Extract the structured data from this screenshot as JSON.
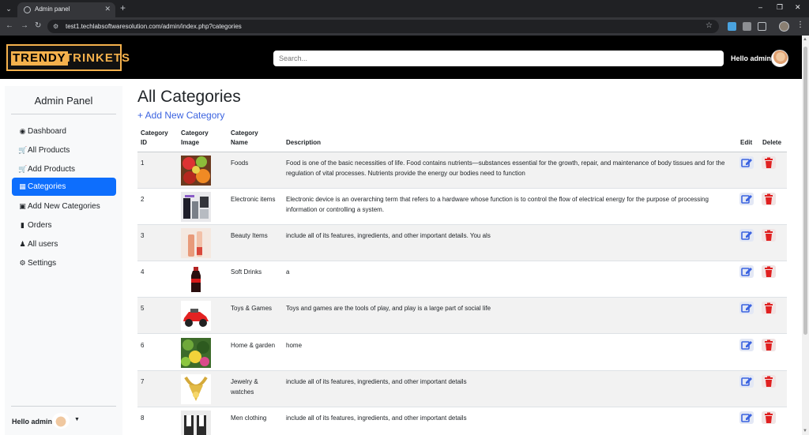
{
  "browser": {
    "tab_title": "Admin panel",
    "url": "test1.techlabsoftwaresolution.com/admin/index.php?categories"
  },
  "header": {
    "logo_part1": "TRENDY",
    "logo_part2": "TRINKETS",
    "search_placeholder": "Search...",
    "greeting": "Hello admin"
  },
  "sidebar": {
    "title": "Admin Panel",
    "items": [
      {
        "label": "Dashboard",
        "icon": "palette-icon"
      },
      {
        "label": "All Products",
        "icon": "cart-icon"
      },
      {
        "label": "Add Products",
        "icon": "cart-plus-icon"
      },
      {
        "label": "Categories",
        "icon": "calendar-grid-icon",
        "active": true
      },
      {
        "label": "Add New Categories",
        "icon": "calendar-plus-icon"
      },
      {
        "label": "Orders",
        "icon": "book-icon"
      },
      {
        "label": "All users",
        "icon": "user-icon"
      },
      {
        "label": "Settings",
        "icon": "gear-icon"
      }
    ],
    "footer_greeting": "Hello admin"
  },
  "main": {
    "title": "All Categories",
    "add_link": "+ Add New Category",
    "columns": {
      "id": "Category ID",
      "image": "Category Image",
      "name": "Category Name",
      "description": "Description",
      "edit": "Edit",
      "delete": "Delete"
    },
    "rows": [
      {
        "id": "1",
        "name": "Foods",
        "description": "Food is one of the basic necessities of life. Food contains nutrients—substances essential for the growth, repair, and maintenance of body tissues and for the regulation of vital processes. Nutrients provide the energy our bodies need to function",
        "thumb": "food-photo"
      },
      {
        "id": "2",
        "name": "Electronic items",
        "description": "Electronic device is an overarching term that refers to a hardware whose function is to control the flow of electrical energy for the purpose of processing information or controlling a system.",
        "thumb": "electronics-photo"
      },
      {
        "id": "3",
        "name": "Beauty Items",
        "description": "include all of its features, ingredients, and other important details. You als",
        "thumb": "beauty-photo"
      },
      {
        "id": "4",
        "name": "Soft Drinks",
        "description": "a",
        "thumb": "soda-bottle-photo"
      },
      {
        "id": "5",
        "name": "Toys & Games",
        "description": "Toys and games are the tools of play, and play is a large part of social life",
        "thumb": "toy-car-photo"
      },
      {
        "id": "6",
        "name": "Home & garden",
        "description": "home",
        "thumb": "garden-photo"
      },
      {
        "id": "7",
        "name": "Jewelry & watches",
        "description": "include all of its features, ingredients, and other important details",
        "thumb": "jewelry-photo"
      },
      {
        "id": "8",
        "name": "Men clothing",
        "description": "include all of its features, ingredients, and other important details",
        "thumb": "men-clothing-photo"
      }
    ]
  },
  "colors": {
    "active_blue": "#0d6efd",
    "link_blue": "#3b63e0",
    "delete_red": "#e02020",
    "logo_gold": "#f5b14c"
  }
}
